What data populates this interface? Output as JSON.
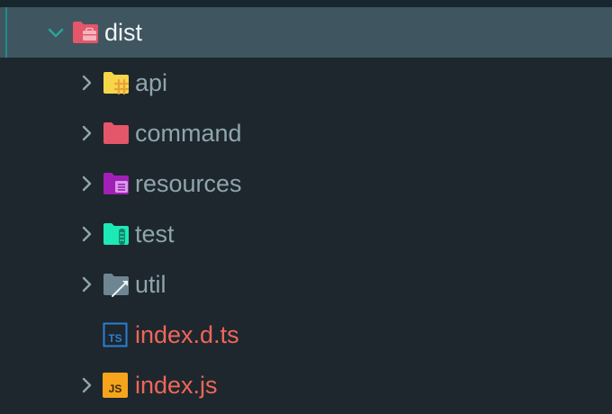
{
  "explorer": {
    "root": {
      "label": "dist",
      "expanded": true,
      "icon": "folder-dist-open-icon",
      "icon_color": "#e4566a"
    },
    "items": [
      {
        "label": "api",
        "type": "folder",
        "expanded": false,
        "icon": "folder-api-icon",
        "icon_color": "#f7d64a"
      },
      {
        "label": "command",
        "type": "folder",
        "expanded": false,
        "icon": "folder-command-icon",
        "icon_color": "#e4566a"
      },
      {
        "label": "resources",
        "type": "folder",
        "expanded": false,
        "icon": "folder-resources-icon",
        "icon_color": "#a21fb7"
      },
      {
        "label": "test",
        "type": "folder",
        "expanded": false,
        "icon": "folder-test-icon",
        "icon_color": "#1de9b6"
      },
      {
        "label": "util",
        "type": "folder",
        "expanded": false,
        "icon": "folder-util-icon",
        "icon_color": "#6e8691"
      },
      {
        "label": "index.d.ts",
        "type": "file",
        "icon": "typescript-def-icon",
        "icon_color": "#2a7fd4"
      },
      {
        "label": "index.js",
        "type": "file",
        "icon": "javascript-icon",
        "icon_color": "#f7a41d"
      }
    ]
  },
  "colors": {
    "background": "#1e272d",
    "selected_row": "#3f5660",
    "folder_text": "#8fa5ad",
    "file_text": "#f0665a",
    "chevron": "#8fa5ad",
    "chevron_open": "#26a69a"
  }
}
